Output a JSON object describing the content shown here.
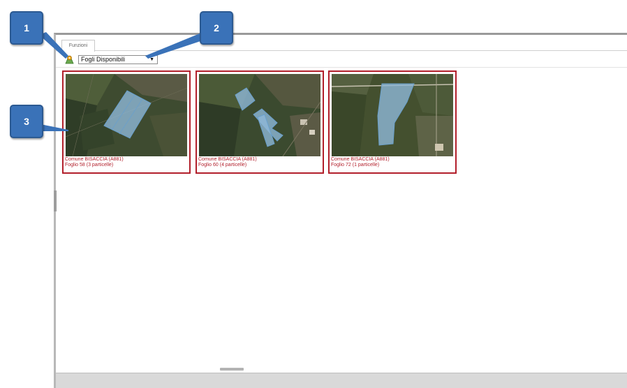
{
  "tab": {
    "label": "Funzioni"
  },
  "toolbar": {
    "icon": "map-pin-icon",
    "select_value": "Fogli Disponibili"
  },
  "thumbnails": [
    {
      "comune": "Comune BISACCIA (A881)",
      "foglio": "Foglio 58 (3 particelle)"
    },
    {
      "comune": "Comune BISACCIA (A881)",
      "foglio": "Foglio 60 (4 particelle)"
    },
    {
      "comune": "Comune BISACCIA (A881)",
      "foglio": "Foglio 72 (1 particelle)"
    }
  ],
  "callouts": [
    "1",
    "2",
    "3"
  ],
  "colors": {
    "accent_border": "#b21f2b",
    "callout": "#3a72b8",
    "parcel_fill": "#8fb8d8"
  }
}
